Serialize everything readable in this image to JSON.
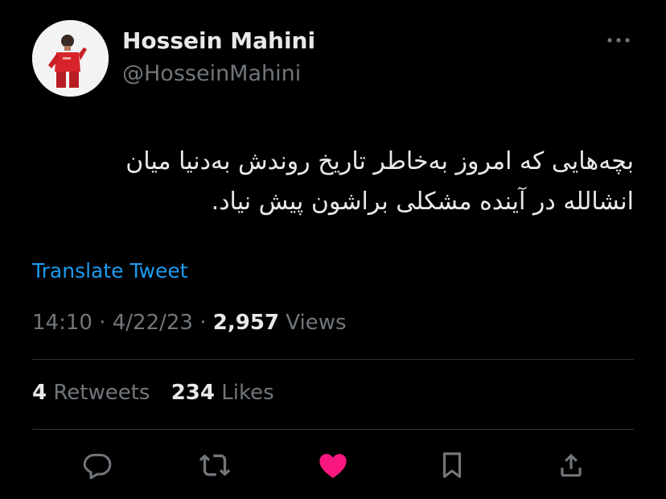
{
  "user": {
    "display_name": "Hossein Mahini",
    "handle": "@HosseinMahini"
  },
  "tweet": {
    "text_lines": [
      "بچه‌هایی که امروز به‌خاطر تاریخ روندش به‌دنیا میان",
      "انشالله در آینده مشکلی براشون پیش نیاد."
    ],
    "translate_label": "Translate Tweet",
    "time": "14:10",
    "date": "4/22/23",
    "separator": "·",
    "views_count": "2,957",
    "views_label": "Views"
  },
  "stats": {
    "retweets_count": "4",
    "retweets_label": "Retweets",
    "likes_count": "234",
    "likes_label": "Likes"
  },
  "actions": {
    "reply_icon": "reply-icon",
    "retweet_icon": "retweet-icon",
    "like_icon": "heart-icon",
    "bookmark_icon": "bookmark-icon",
    "share_icon": "share-icon"
  },
  "colors": {
    "background": "#000000",
    "primary_text": "#e7e9ea",
    "secondary_text": "#71767b",
    "link": "#1d9bf0",
    "liked": "#f91880",
    "divider": "#2f3336"
  }
}
